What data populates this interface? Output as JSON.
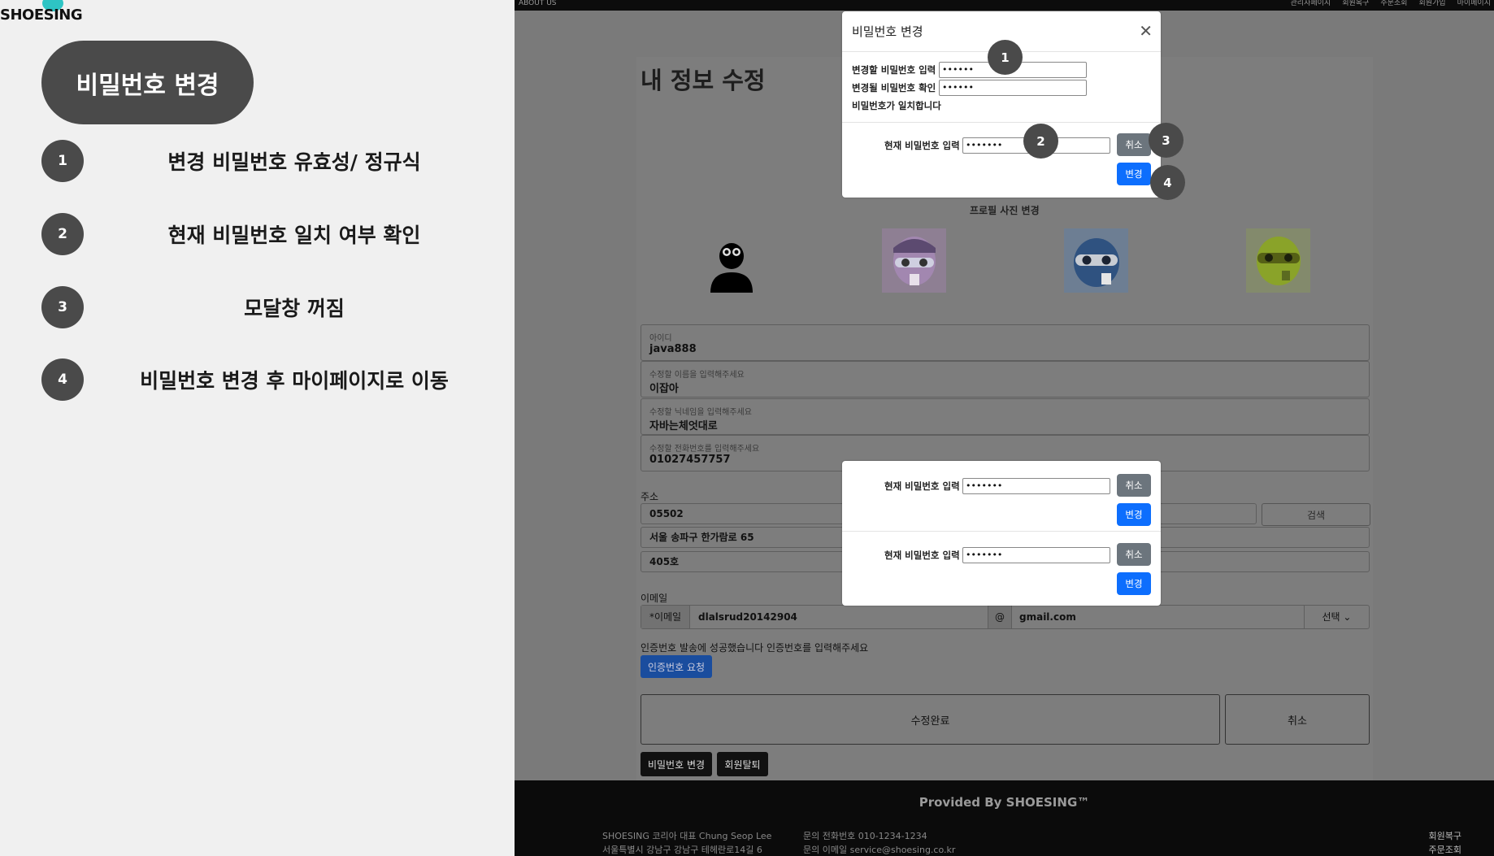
{
  "left_panel": {
    "brand": "SHOESING",
    "title": "비밀번호 변경",
    "steps": [
      {
        "num": "1",
        "text": "변경 비밀번호 유효성/ 정규식"
      },
      {
        "num": "2",
        "text": "현재 비밀번호 일치 여부 확인"
      },
      {
        "num": "3",
        "text": "모달창 꺼짐"
      },
      {
        "num": "4",
        "text": "비밀번호 변경 후 마이페이지로 이동"
      }
    ]
  },
  "topbar": {
    "about": "ABOUT US",
    "links": [
      "관리자페이지",
      "회원복구",
      "주문조회",
      "회원가입",
      "마이페이지"
    ]
  },
  "page": {
    "title": "내 정보 수정",
    "photo_label": "프로필 사진 변경",
    "fields": [
      {
        "label": "아이디",
        "value": "java888"
      },
      {
        "label": "수정할 이름을 입력해주세요",
        "value": "이잡아"
      },
      {
        "label": "수정할 닉네임을 입력해주세요",
        "value": "자바는체엇대로"
      },
      {
        "label": "수정할 전화번호를 입력해주세요",
        "value": "01027457757"
      }
    ],
    "address_label": "주소",
    "postcode": "05502",
    "address1": "서울 송파구 한가람로 65",
    "address2": "405호",
    "search_label": "검색",
    "email_label": "이메일",
    "email_prefix": "*이메일",
    "email_id": "dlalsrud20142904",
    "email_at": "@",
    "email_domain": "gmail.com",
    "email_select": "선택",
    "verify_msg": "인증번호 발송에 성공했습니다 인증번호를 입력해주세요",
    "verify_btn": "인증번호 요청",
    "submit_label": "수정완료",
    "cancel_label": "취소",
    "pw_change_btn": "비밀번호 변경",
    "withdraw_btn": "회원탈퇴"
  },
  "footer": {
    "provided": "Provided By SHOESING™",
    "line1": "SHOESING 코리아 대표 Chung Seop Lee",
    "line2": "서울특별시 강남구 강남구 테헤란로14길 6",
    "line3": "문의 전화번호 010-1234-1234",
    "line4": "문의 이메일 service@shoesing.co.kr",
    "line5": "회원복구",
    "line6": "주문조회"
  },
  "modal": {
    "title": "비밀번호 변경",
    "close": "✕",
    "new_pw_label": "변경할 비밀번호 입력",
    "new_pw_value": "••••••",
    "confirm_pw_label": "변경될 비밀번호 확인",
    "confirm_pw_value": "••••••",
    "match_msg": "비밀번호가 일치합니다",
    "current_pw_label": "현재 비밀번호 입력",
    "current_pw_value": "•••••••",
    "cancel": "취소",
    "change": "변경"
  },
  "markers": [
    "1",
    "2",
    "3",
    "4"
  ]
}
